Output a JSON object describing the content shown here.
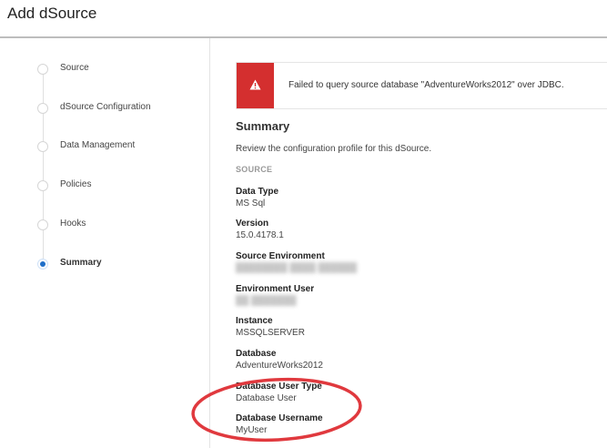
{
  "window": {
    "title": "Add dSource"
  },
  "sidebar": {
    "steps": [
      {
        "label": "Source",
        "active": false
      },
      {
        "label": "dSource Configuration",
        "active": false
      },
      {
        "label": "Data Management",
        "active": false
      },
      {
        "label": "Policies",
        "active": false
      },
      {
        "label": "Hooks",
        "active": false
      },
      {
        "label": "Summary",
        "active": true
      }
    ]
  },
  "alert": {
    "icon": "warning-icon",
    "message": "Failed to query source database \"AdventureWorks2012\" over JDBC.",
    "color": "#d42f2f"
  },
  "summary": {
    "title": "Summary",
    "description": "Review the configuration profile for this dSource.",
    "section": "SOURCE",
    "fields": [
      {
        "label": "Data Type",
        "value": "MS Sql"
      },
      {
        "label": "Version",
        "value": "15.0.4178.1"
      },
      {
        "label": "Source Environment",
        "value": "",
        "redacted": true
      },
      {
        "label": "Environment User",
        "value": "",
        "redacted": true
      },
      {
        "label": "Instance",
        "value": "MSSQLSERVER"
      },
      {
        "label": "Database",
        "value": "AdventureWorks2012"
      },
      {
        "label": "Database User Type",
        "value": "Database User"
      },
      {
        "label": "Database Username",
        "value": "MyUser"
      }
    ]
  },
  "colors": {
    "accent": "#1e6ec8",
    "annotation": "#e0393e"
  }
}
